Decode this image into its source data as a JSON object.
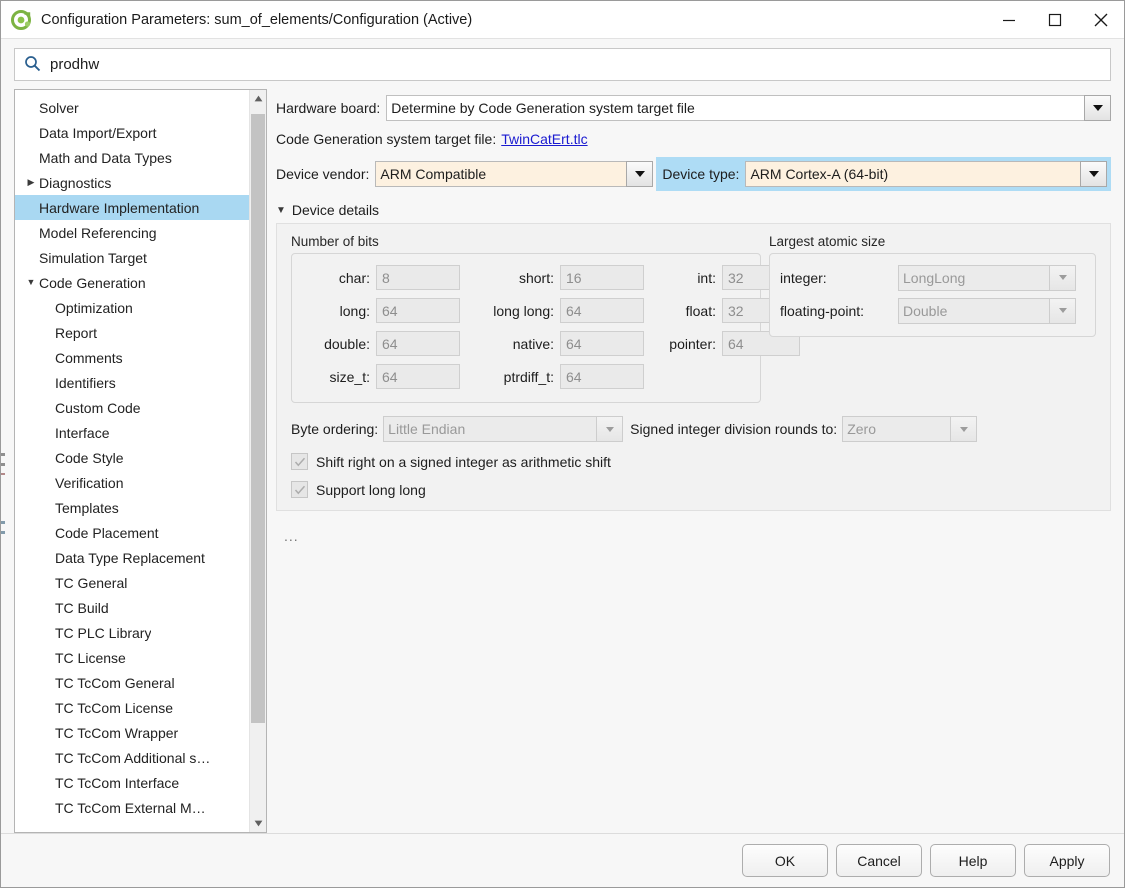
{
  "window": {
    "title": "Configuration Parameters: sum_of_elements/Configuration (Active)",
    "app_icon": "simulink-icon",
    "minimize_label": "—",
    "maximize_label": "□",
    "close_label": "✕"
  },
  "search": {
    "icon": "search-icon",
    "value": "prodhw",
    "placeholder": "Search"
  },
  "tree": {
    "items": [
      {
        "label": "Solver",
        "level": 0,
        "twisty": "",
        "selected": false
      },
      {
        "label": "Data Import/Export",
        "level": 0,
        "twisty": "",
        "selected": false
      },
      {
        "label": "Math and Data Types",
        "level": 0,
        "twisty": "",
        "selected": false
      },
      {
        "label": "Diagnostics",
        "level": 0,
        "twisty": "▶",
        "selected": false
      },
      {
        "label": "Hardware Implementation",
        "level": 0,
        "twisty": "",
        "selected": true
      },
      {
        "label": "Model Referencing",
        "level": 0,
        "twisty": "",
        "selected": false
      },
      {
        "label": "Simulation Target",
        "level": 0,
        "twisty": "",
        "selected": false
      },
      {
        "label": "Code Generation",
        "level": 0,
        "twisty": "▼",
        "selected": false
      },
      {
        "label": "Optimization",
        "level": 1,
        "twisty": "",
        "selected": false
      },
      {
        "label": "Report",
        "level": 1,
        "twisty": "",
        "selected": false
      },
      {
        "label": "Comments",
        "level": 1,
        "twisty": "",
        "selected": false
      },
      {
        "label": "Identifiers",
        "level": 1,
        "twisty": "",
        "selected": false
      },
      {
        "label": "Custom Code",
        "level": 1,
        "twisty": "",
        "selected": false
      },
      {
        "label": "Interface",
        "level": 1,
        "twisty": "",
        "selected": false
      },
      {
        "label": "Code Style",
        "level": 1,
        "twisty": "",
        "selected": false
      },
      {
        "label": "Verification",
        "level": 1,
        "twisty": "",
        "selected": false
      },
      {
        "label": "Templates",
        "level": 1,
        "twisty": "",
        "selected": false
      },
      {
        "label": "Code Placement",
        "level": 1,
        "twisty": "",
        "selected": false
      },
      {
        "label": "Data Type Replacement",
        "level": 1,
        "twisty": "",
        "selected": false
      },
      {
        "label": "TC General",
        "level": 1,
        "twisty": "",
        "selected": false
      },
      {
        "label": "TC Build",
        "level": 1,
        "twisty": "",
        "selected": false
      },
      {
        "label": "TC PLC Library",
        "level": 1,
        "twisty": "",
        "selected": false
      },
      {
        "label": "TC License",
        "level": 1,
        "twisty": "",
        "selected": false
      },
      {
        "label": "TC TcCom General",
        "level": 1,
        "twisty": "",
        "selected": false
      },
      {
        "label": "TC TcCom License",
        "level": 1,
        "twisty": "",
        "selected": false
      },
      {
        "label": "TC TcCom Wrapper",
        "level": 1,
        "twisty": "",
        "selected": false
      },
      {
        "label": "TC TcCom Additional s…",
        "level": 1,
        "twisty": "",
        "selected": false
      },
      {
        "label": "TC TcCom Interface",
        "level": 1,
        "twisty": "",
        "selected": false
      },
      {
        "label": "TC TcCom External M…",
        "level": 1,
        "twisty": "",
        "selected": false
      }
    ],
    "scroll_up_icon": "scroll-up-arrow",
    "scroll_down_icon": "scroll-down-arrow"
  },
  "main": {
    "hardware_board": {
      "label": "Hardware board:",
      "value": "Determine by Code Generation system target file"
    },
    "system_target_file": {
      "label": "Code Generation system target file:",
      "link": "TwinCatErt.tlc"
    },
    "device_vendor": {
      "label": "Device vendor:",
      "value": "ARM Compatible",
      "highlight_color": "#fdf1e0"
    },
    "device_type": {
      "label": "Device type:",
      "value": "ARM Cortex-A (64-bit)",
      "highlight_color": "#aedcf5",
      "field_color": "#fdf1e0"
    },
    "device_details": {
      "label": "Device details",
      "twisty": "▼"
    },
    "number_of_bits": {
      "title": "Number of bits",
      "rows": [
        [
          {
            "label": "char:",
            "value": "8"
          },
          {
            "label": "short:",
            "value": "16"
          },
          {
            "label": "int:",
            "value": "32"
          }
        ],
        [
          {
            "label": "long:",
            "value": "64"
          },
          {
            "label": "long long:",
            "value": "64"
          },
          {
            "label": "float:",
            "value": "32"
          }
        ],
        [
          {
            "label": "double:",
            "value": "64"
          },
          {
            "label": "native:",
            "value": "64"
          },
          {
            "label": "pointer:",
            "value": "64"
          }
        ],
        [
          {
            "label": "size_t:",
            "value": "64"
          },
          {
            "label": "ptrdiff_t:",
            "value": "64"
          },
          {
            "label": "",
            "value": ""
          }
        ]
      ]
    },
    "largest_atomic_size": {
      "title": "Largest atomic size",
      "rows": [
        {
          "label": "integer:",
          "value": "LongLong"
        },
        {
          "label": "floating-point:",
          "value": "Double"
        }
      ]
    },
    "byte_ordering": {
      "label": "Byte ordering:",
      "value": "Little Endian"
    },
    "signed_integer_division": {
      "label": "Signed integer division rounds to:",
      "value": "Zero"
    },
    "checkboxes": [
      {
        "label": "Shift right on a signed integer as arithmetic shift",
        "checked": true,
        "enabled": false
      },
      {
        "label": "Support long long",
        "checked": true,
        "enabled": false
      }
    ],
    "overflow_indicator": "..."
  },
  "footer": {
    "buttons": [
      {
        "label": "OK"
      },
      {
        "label": "Cancel"
      },
      {
        "label": "Help"
      },
      {
        "label": "Apply"
      }
    ]
  }
}
